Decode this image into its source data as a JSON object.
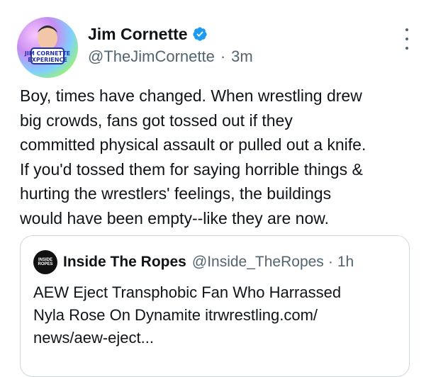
{
  "author": {
    "display_name": "Jim Cornette",
    "handle": "@TheJimCornette",
    "separator": "·",
    "time": "3m",
    "avatar_caption": "JIM CORNETTE EXPERIENCE"
  },
  "tweet": {
    "lines": [
      "Boy, times have changed. When wrestling drew",
      "big crowds, fans got tossed out if they",
      "committed physical assault or pulled out a knife.",
      "If you'd tossed them for saying horrible things &",
      "hurting the wrestlers' feelings, the buildings",
      "would have been empty--like they are now."
    ]
  },
  "quote": {
    "avatar_text": "INSIDE ROPES",
    "display_name": "Inside The Ropes",
    "handle": "@Inside_TheRopes",
    "separator": "·",
    "time": "1h",
    "lines": [
      "AEW Eject Transphobic Fan Who Harrassed",
      "Nyla Rose On Dynamite itrwrestling.com/",
      "news/aew-eject..."
    ]
  },
  "icons": {
    "verified": "verified-badge-icon",
    "more": "more-options-icon"
  },
  "colors": {
    "text": "#0f1419",
    "secondary": "#536471",
    "verified": "#1d9bf0",
    "border": "#cfd9de"
  }
}
